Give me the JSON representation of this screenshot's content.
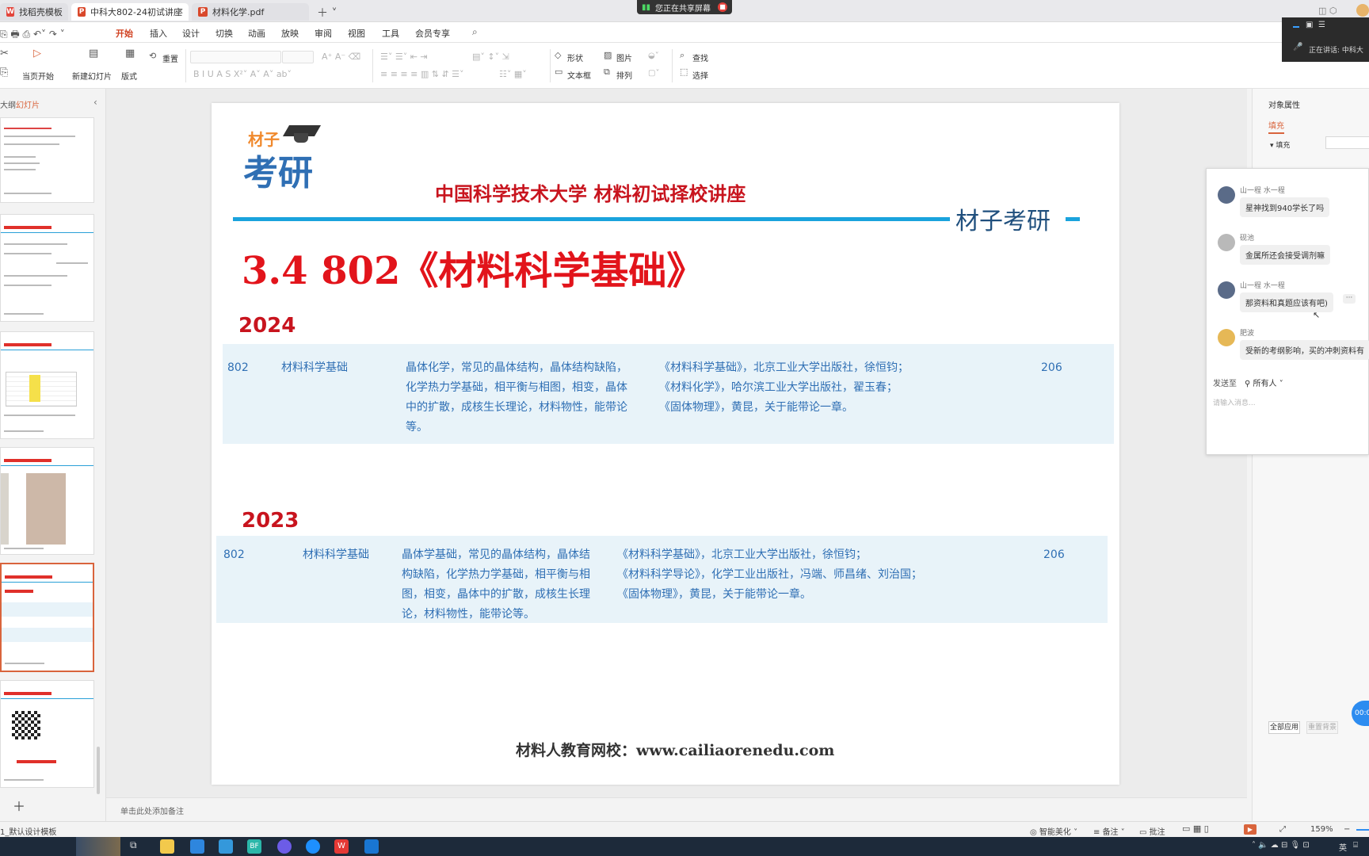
{
  "tabs": [
    {
      "label": "找稻壳模板",
      "icon": "wps-home-icon"
    },
    {
      "label": "中科大802-24初试讲座",
      "icon": "ppt-file-icon"
    },
    {
      "label": "材料化学.pdf",
      "icon": "pdf-file-icon"
    }
  ],
  "share_banner": "您正在共享屏幕",
  "menu": [
    "开始",
    "插入",
    "设计",
    "切换",
    "动画",
    "放映",
    "审阅",
    "视图",
    "工具",
    "会员专享"
  ],
  "ribbon": {
    "play_from_current": "当页开始",
    "new_slide": "新建幻灯片",
    "layout": "版式",
    "reset": "重置",
    "shape": "形状",
    "picture": "图片",
    "find": "查找",
    "textbox": "文本框",
    "arrange": "排列",
    "select": "选择"
  },
  "left_panel": {
    "tab_outline": "大纲",
    "tab_slides": "幻灯片"
  },
  "slide": {
    "logo_top": "材子",
    "logo_bottom": "考研",
    "header_title": "中国科学技术大学 材料初试择校讲座",
    "brand": "材子考研",
    "section_title": "3.4  802《材料科学基础》",
    "year1": "2024",
    "row1": {
      "code": "802",
      "subject": "材料科学基础",
      "scope": [
        "晶体化学，常见的晶体结构，晶体结构缺陷，",
        "化学热力学基础，相平衡与相图，相变，晶体",
        "中的扩散，成核生长理论，材料物性，能带论",
        "等。"
      ],
      "books": [
        "《材料科学基础》，北京工业大学出版社，徐恒钧；",
        "《材料化学》，哈尔滨工业大学出版社，翟玉春；",
        "《固体物理》，黄昆，关于能带论一章。"
      ],
      "num": "206"
    },
    "year2": "2023",
    "row2": {
      "code": "802",
      "subject": "材料科学基础",
      "scope": [
        "晶体学基础，常见的晶体结构，晶体结",
        "构缺陷，化学热力学基础，相平衡与相",
        "图，相变，晶体中的扩散，成核生长理",
        "论，材料物性，能带论等。"
      ],
      "books": [
        "《材料科学基础》，北京工业大学出版社，徐恒钧；",
        "《材料科学导论》，化学工业出版社，冯端、师昌绪、刘治国；",
        "《固体物理》，黄昆，关于能带论一章。"
      ],
      "num": "206"
    },
    "footer": "材料人教育网校：www.cailiaorenedu.com"
  },
  "notes_placeholder": "单击此处添加备注",
  "right_panel": {
    "title": "对象属性",
    "tab_fill": "填充",
    "fill_label": "填充",
    "apply_all": "全部应用",
    "reset_bg": "重置背景"
  },
  "chat": {
    "messages": [
      {
        "name": "山一程 水一程",
        "text": "星神找到940学长了吗"
      },
      {
        "name": "砚池",
        "text": "金属所还会接受调剂嘛"
      },
      {
        "name": "山一程 水一程",
        "text": "那资料和真题应该有吧)"
      },
      {
        "name": "肥波",
        "text": "受新的考纲影响，买的冲刺资料有"
      }
    ],
    "send_to_label": "发送至",
    "send_to_value": "所有人",
    "input_placeholder": "请输入消息..."
  },
  "overlay": {
    "speaking": "正在讲话: 中科大"
  },
  "timer_badge": "00:0",
  "status": {
    "template": "1_默认设计模板",
    "beautify": "智能美化",
    "notes": "备注",
    "comments": "批注",
    "zoom": "159%"
  },
  "taskbar_lang": "英"
}
